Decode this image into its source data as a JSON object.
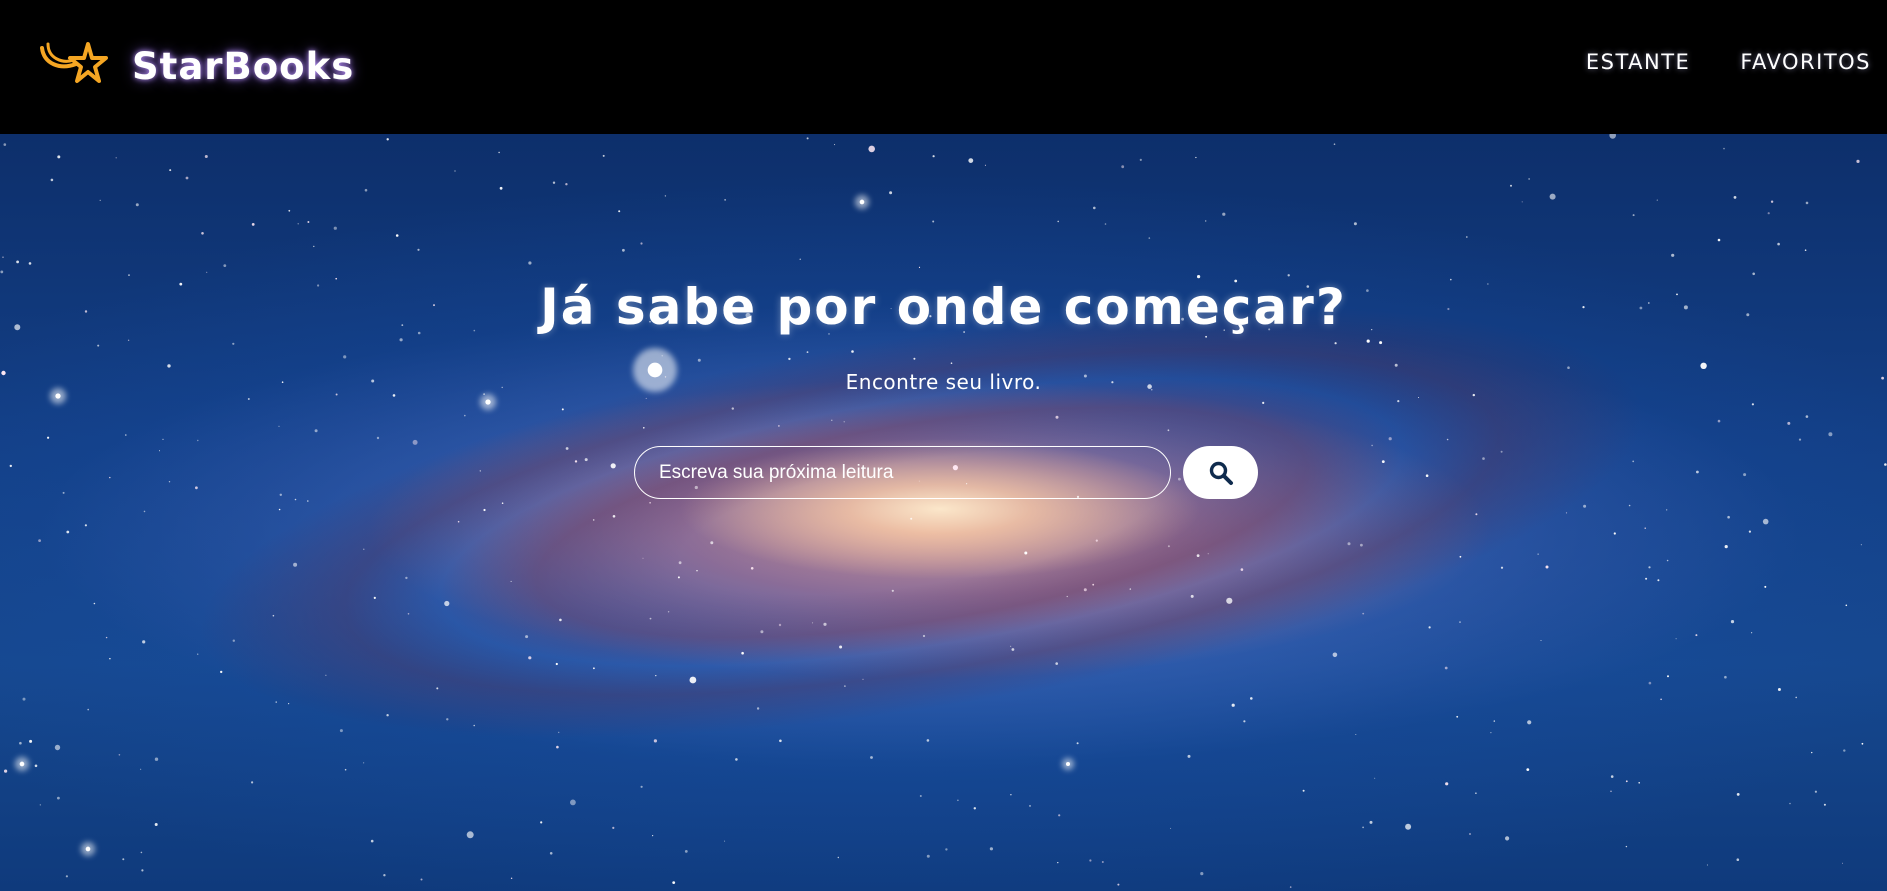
{
  "header": {
    "brand_name": "StarBooks",
    "logo_icon": "shooting-star-icon",
    "nav": [
      {
        "label": "ESTANTE"
      },
      {
        "label": "FAVORITOS"
      }
    ]
  },
  "hero": {
    "title": "Já sabe por onde começar?",
    "subtitle": "Encontre seu livro.",
    "search": {
      "placeholder": "Escreva sua próxima leitura",
      "value": "",
      "button_icon": "search-icon"
    }
  },
  "colors": {
    "header_bg": "#000000",
    "logo_accent": "#f5a623",
    "text": "#ffffff",
    "search_icon": "#0f2b4d"
  }
}
